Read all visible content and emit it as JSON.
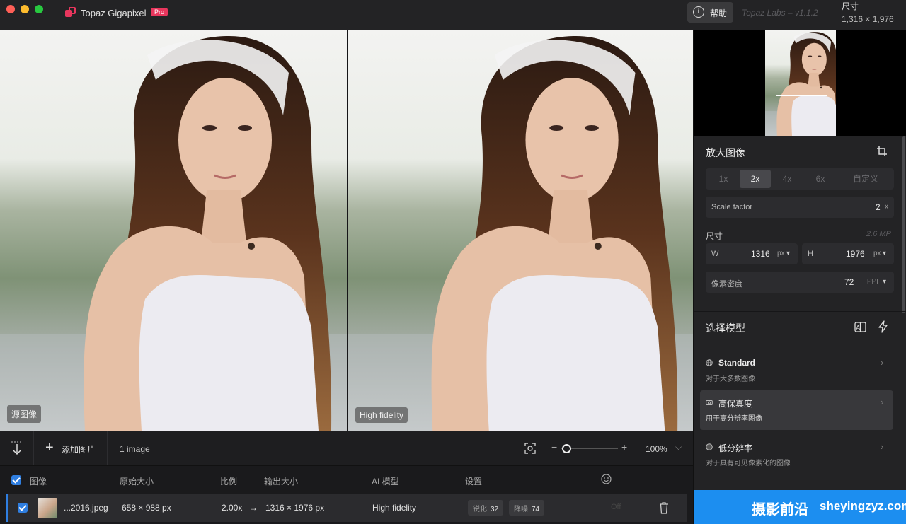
{
  "app": {
    "name": "Topaz Gigapixel",
    "badge": "Pro",
    "version": "Topaz Labs – v1.1.2",
    "help_label": "帮助"
  },
  "header_size": {
    "title": "尺寸",
    "value": "1,316 × 1,976"
  },
  "panes": {
    "left_label": "源图像",
    "right_label": "High fidelity"
  },
  "toolbar": {
    "add_label": "添加图片",
    "count": "1 image",
    "zoom": "100%",
    "zoom_level": 0.1
  },
  "table": {
    "headers": {
      "image": "图像",
      "original": "原始大小",
      "ratio": "比例",
      "output": "输出大小",
      "model": "AI 模型",
      "settings": "设置"
    },
    "rows": [
      {
        "name": "...2016.jpeg",
        "original": "658 × 988 px",
        "ratio": "2.00x",
        "arrow": "→",
        "output": "1316 × 1976 px",
        "model": "High fidelity",
        "sharpen_label": "锐化",
        "sharpen_value": "32",
        "denoise_label": "降噪",
        "denoise_value": "74",
        "face": "Off"
      }
    ]
  },
  "sidebar": {
    "upscale": {
      "title": "放大图像",
      "scales": [
        "1x",
        "2x",
        "4x",
        "6x",
        "自定义"
      ],
      "active_scale": "2x",
      "scale_factor_label": "Scale factor",
      "scale_factor_value": "2",
      "scale_factor_unit": "x",
      "size_title": "尺寸",
      "megapixels": "2.6 MP",
      "width_label": "W",
      "width_value": "1316",
      "width_unit": "px",
      "height_label": "H",
      "height_value": "1976",
      "height_unit": "px",
      "ppi_label": "像素密度",
      "ppi_value": "72",
      "ppi_unit": "PPI"
    },
    "models": {
      "title": "选择模型",
      "items": [
        {
          "name": "Standard",
          "desc": "对于大多数图像"
        },
        {
          "name": "高保真度",
          "desc": "用于高分辨率图像"
        },
        {
          "name": "低分辨率",
          "desc": "对于具有可见像素化的图像"
        }
      ],
      "active": "高保真度"
    },
    "watermark_cn": "摄影前沿",
    "watermark_url": "sheyingzyz.com"
  }
}
